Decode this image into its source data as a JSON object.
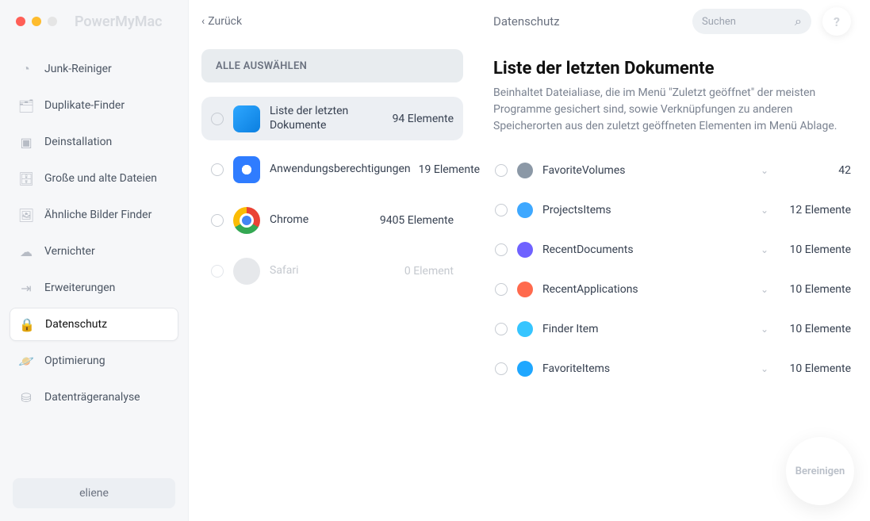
{
  "app_title": "PowerMyMac",
  "sidebar": {
    "items": [
      {
        "label": "Junk-Reiniger"
      },
      {
        "label": "Duplikate-Finder"
      },
      {
        "label": "Deinstallation"
      },
      {
        "label": "Große und alte Dateien"
      },
      {
        "label": "Ähnliche Bilder Finder"
      },
      {
        "label": "Vernichter"
      },
      {
        "label": "Erweiterungen"
      },
      {
        "label": "Datenschutz"
      },
      {
        "label": "Optimierung"
      },
      {
        "label": "Datenträgeranalyse"
      }
    ],
    "user": "eliene"
  },
  "mid": {
    "back": "Zurück",
    "select_all": "ALLE AUSWÄHLEN",
    "categories": [
      {
        "name": "Liste der letzten Dokumente",
        "count": "94 Elemente"
      },
      {
        "name": "Anwendungsberechtigungen",
        "count": "19 Elemente"
      },
      {
        "name": "Chrome",
        "count": "9405 Elemente"
      },
      {
        "name": "Safari",
        "count": "0 Element"
      }
    ]
  },
  "right": {
    "section": "Datenschutz",
    "search_placeholder": "Suchen",
    "help": "?",
    "title": "Liste der letzten Dokumente",
    "desc": "Beinhaltet Dateialiase, die im Menü \"Zuletzt geöffnet\" der meisten Programme gesichert sind, sowie Verknüpfungen zu anderen Speicherorten aus den zuletzt geöffneten Elementen im Menü Ablage.",
    "rows": [
      {
        "name": "FavoriteVolumes",
        "count": "42"
      },
      {
        "name": "ProjectsItems",
        "count": "12 Elemente"
      },
      {
        "name": "RecentDocuments",
        "count": "10 Elemente"
      },
      {
        "name": "RecentApplications",
        "count": "10 Elemente"
      },
      {
        "name": "Finder Item",
        "count": "10 Elemente"
      },
      {
        "name": "FavoriteItems",
        "count": "10 Elemente"
      }
    ],
    "clean": "Bereinigen"
  }
}
